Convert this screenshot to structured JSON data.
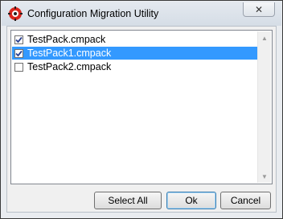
{
  "window": {
    "title": "Configuration Migration Utility",
    "icon": "gear-app-icon",
    "close_glyph": "✕"
  },
  "list": {
    "items": [
      {
        "label": "TestPack.cmpack",
        "checked": true,
        "selected": false
      },
      {
        "label": "TestPack1.cmpack",
        "checked": true,
        "selected": true
      },
      {
        "label": "TestPack2.cmpack",
        "checked": false,
        "selected": false
      }
    ],
    "scroll_up_glyph": "▲",
    "scroll_down_glyph": "▼"
  },
  "buttons": {
    "select_all": "Select All",
    "ok": "Ok",
    "cancel": "Cancel"
  },
  "colors": {
    "selection": "#3399ff",
    "accent_icon": "#d9261c"
  }
}
